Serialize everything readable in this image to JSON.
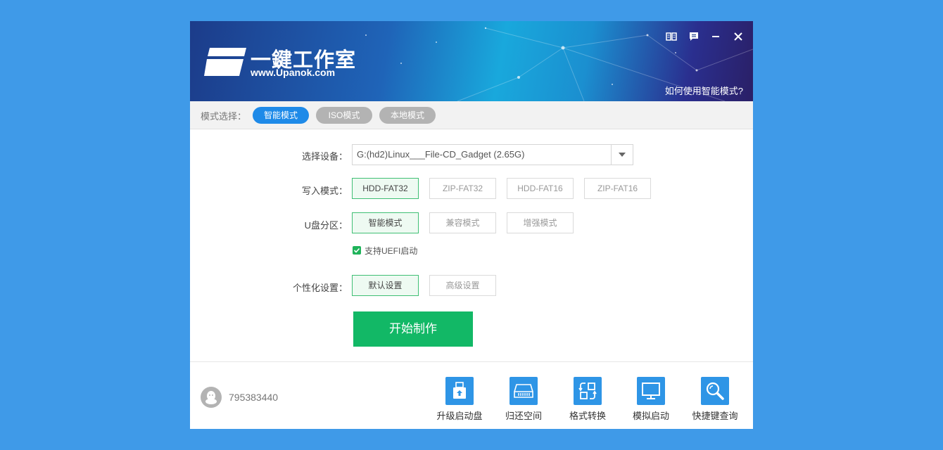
{
  "header": {
    "logo_title": "一鍵工作室",
    "logo_url": "www.Upanok.com",
    "help_link": "如何使用智能模式?"
  },
  "window_controls": {
    "icons": [
      "book-icon",
      "chat-icon",
      "minimize-icon",
      "close-icon"
    ]
  },
  "mode_bar": {
    "label": "模式选择：",
    "modes": [
      {
        "label": "智能模式",
        "active": true
      },
      {
        "label": "ISO模式",
        "active": false
      },
      {
        "label": "本地模式",
        "active": false
      }
    ]
  },
  "form": {
    "device": {
      "label": "选择设备：",
      "value": "G:(hd2)Linux___File-CD_Gadget (2.65G)"
    },
    "write_mode": {
      "label": "写入模式：",
      "options": [
        "HDD-FAT32",
        "ZIP-FAT32",
        "HDD-FAT16",
        "ZIP-FAT16"
      ],
      "selected": "HDD-FAT32"
    },
    "partition": {
      "label": "U盘分区：",
      "options": [
        "智能模式",
        "兼容模式",
        "增强模式"
      ],
      "selected": "智能模式"
    },
    "uefi": {
      "label": "支持UEFI启动",
      "checked": true
    },
    "personalize": {
      "label": "个性化设置：",
      "options": [
        "默认设置",
        "高级设置"
      ],
      "selected": "默认设置"
    },
    "start_button": "开始制作"
  },
  "footer": {
    "qq_number": "795383440",
    "tools": [
      {
        "label": "升级启动盘",
        "icon": "upgrade-usb-icon"
      },
      {
        "label": "归还空间",
        "icon": "disk-space-icon"
      },
      {
        "label": "格式转换",
        "icon": "format-convert-icon"
      },
      {
        "label": "模拟启动",
        "icon": "monitor-icon"
      },
      {
        "label": "快捷键查询",
        "icon": "search-icon"
      }
    ]
  },
  "colors": {
    "page_background": "#3f9ae8",
    "active_mode": "#1e8ae8",
    "inactive_mode": "#b3b3b3",
    "selected_option_border": "#3fbf74",
    "start_button": "#12b866",
    "tool_icon": "#2e95e6"
  }
}
